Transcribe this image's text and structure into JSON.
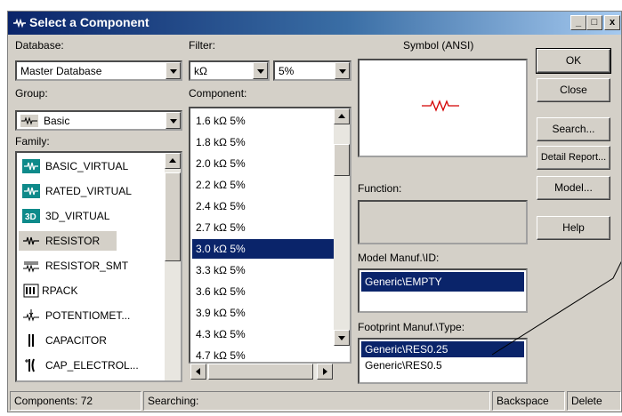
{
  "window": {
    "title": "Select a Component",
    "minimize_glyph": "_",
    "maximize_glyph": "□",
    "close_glyph": "x",
    "icon": "component-app-icon"
  },
  "database": {
    "label": "Database:",
    "value": "Master Database"
  },
  "group": {
    "label": "Group:",
    "value": "Basic",
    "icon": "resistor-group-icon"
  },
  "family": {
    "label": "Family:",
    "items": [
      {
        "label": "BASIC_VIRTUAL",
        "icon": "basic-virtual-icon"
      },
      {
        "label": "RATED_VIRTUAL",
        "icon": "rated-virtual-icon"
      },
      {
        "label": "3D_VIRTUAL",
        "icon": "3d-virtual-icon"
      },
      {
        "label": "RESISTOR",
        "icon": "resistor-icon",
        "highlighted": true
      },
      {
        "label": "RESISTOR_SMT",
        "icon": "resistor-smt-icon"
      },
      {
        "label": "RPACK",
        "icon": "rpack-icon"
      },
      {
        "label": "POTENTIOMET...",
        "icon": "potentiometer-icon"
      },
      {
        "label": "CAPACITOR",
        "icon": "capacitor-icon"
      },
      {
        "label": "CAP_ELECTROL...",
        "icon": "electrolytic-capacitor-icon"
      }
    ]
  },
  "filter": {
    "label": "Filter:",
    "unit": "kΩ",
    "tolerance": "5%"
  },
  "component": {
    "label": "Component:",
    "items": [
      "1.6 kΩ 5%",
      "1.8 kΩ 5%",
      "2.0 kΩ 5%",
      "2.2 kΩ 5%",
      "2.4 kΩ 5%",
      "2.7 kΩ 5%",
      "3.0 kΩ 5%",
      "3.3 kΩ 5%",
      "3.6 kΩ 5%",
      "3.9 kΩ 5%",
      "4.3 kΩ 5%",
      "4.7 kΩ 5%"
    ],
    "selected": "3.0 kΩ 5%"
  },
  "symbol": {
    "label": "Symbol (ANSI)"
  },
  "function": {
    "label": "Function:"
  },
  "model": {
    "label": "Model Manuf.\\ID:",
    "items": [
      "Generic\\EMPTY"
    ],
    "selected": "Generic\\EMPTY"
  },
  "footprint": {
    "label": "Footprint Manuf.\\Type:",
    "items": [
      "Generic\\RES0.25",
      "Generic\\RES0.5"
    ],
    "selected": "Generic\\RES0.25"
  },
  "buttons": {
    "ok": "OK",
    "close": "Close",
    "search": "Search...",
    "detail_report": "Detail Report...",
    "model": "Model...",
    "help": "Help"
  },
  "status": {
    "components": "Components: 72",
    "searching": "Searching:",
    "backspace": "Backspace",
    "delete": "Delete"
  },
  "colors": {
    "selection": "#0a246a",
    "title_start": "#0a246a",
    "title_end": "#a6caf0",
    "resistor_symbol": "#d40000"
  }
}
